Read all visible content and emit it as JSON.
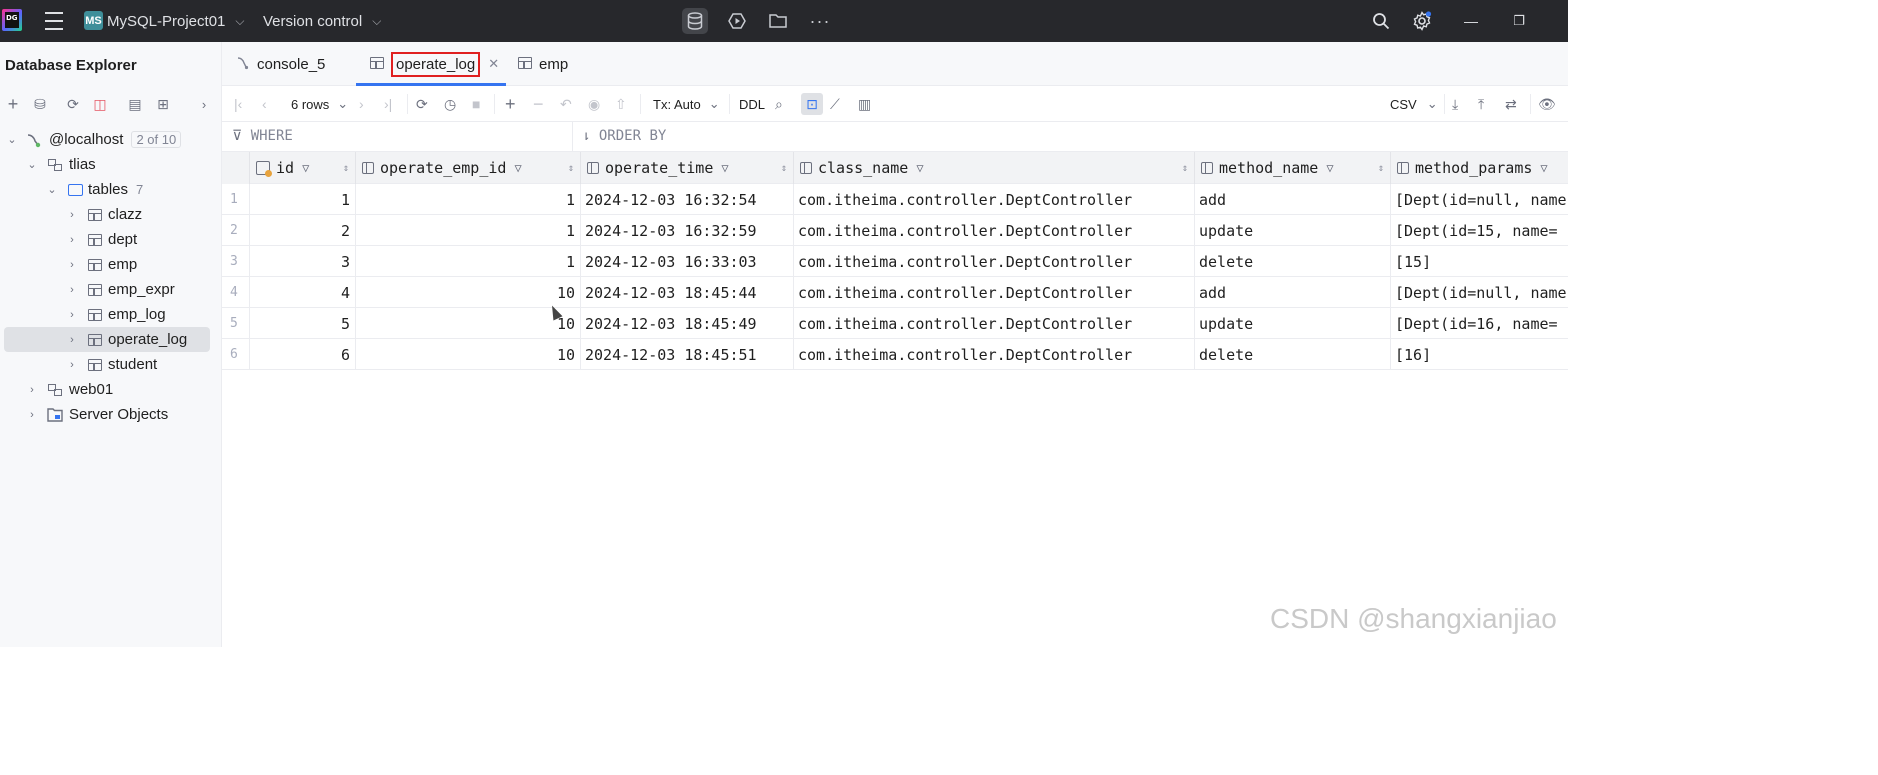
{
  "titlebar": {
    "project_badge": "MS",
    "project_name": "MySQL-Project01",
    "vcs_label": "Version control",
    "ide_logo": "DG"
  },
  "sidebar": {
    "title": "Database Explorer",
    "tree": {
      "host": {
        "label": "@localhost",
        "count": "2 of 10"
      },
      "schema_tlias": {
        "label": "tlias"
      },
      "tables_folder": {
        "label": "tables",
        "count": "7"
      },
      "tables": [
        "clazz",
        "dept",
        "emp",
        "emp_expr",
        "emp_log",
        "operate_log",
        "student"
      ],
      "schema_web01": {
        "label": "web01"
      },
      "server_objects": {
        "label": "Server Objects"
      }
    }
  },
  "tabs": [
    {
      "label": "console_5",
      "icon": "console-icon"
    },
    {
      "label": "operate_log",
      "icon": "table-icon"
    },
    {
      "label": "emp",
      "icon": "table-icon"
    }
  ],
  "grid_toolbar": {
    "rows_label": "6 rows",
    "tx_label": "Tx: Auto",
    "ddl_label": "DDL",
    "export_format": "CSV"
  },
  "filter": {
    "where_placeholder": "WHERE",
    "orderby_placeholder": "ORDER BY"
  },
  "table": {
    "columns": [
      "id",
      "operate_emp_id",
      "operate_time",
      "class_name",
      "method_name",
      "method_params"
    ],
    "rows": [
      {
        "row_num": "1",
        "id": "1",
        "operate_emp_id": "1",
        "operate_time": "2024-12-03 16:32:54",
        "class_name": "com.itheima.controller.DeptController",
        "method_name": "add",
        "method_params": "[Dept(id=null, name"
      },
      {
        "row_num": "2",
        "id": "2",
        "operate_emp_id": "1",
        "operate_time": "2024-12-03 16:32:59",
        "class_name": "com.itheima.controller.DeptController",
        "method_name": "update",
        "method_params": "[Dept(id=15, name="
      },
      {
        "row_num": "3",
        "id": "3",
        "operate_emp_id": "1",
        "operate_time": "2024-12-03 16:33:03",
        "class_name": "com.itheima.controller.DeptController",
        "method_name": "delete",
        "method_params": "[15]"
      },
      {
        "row_num": "4",
        "id": "4",
        "operate_emp_id": "10",
        "operate_time": "2024-12-03 18:45:44",
        "class_name": "com.itheima.controller.DeptController",
        "method_name": "add",
        "method_params": "[Dept(id=null, name"
      },
      {
        "row_num": "5",
        "id": "5",
        "operate_emp_id": "10",
        "operate_time": "2024-12-03 18:45:49",
        "class_name": "com.itheima.controller.DeptController",
        "method_name": "update",
        "method_params": "[Dept(id=16, name="
      },
      {
        "row_num": "6",
        "id": "6",
        "operate_emp_id": "10",
        "operate_time": "2024-12-03 18:45:51",
        "class_name": "com.itheima.controller.DeptController",
        "method_name": "delete",
        "method_params": "[16]"
      }
    ]
  },
  "watermark": "CSDN @shangxianjiao",
  "colors": {
    "titlebar_bg": "#27282c",
    "accent": "#3574f0",
    "highlight_box": "#e02020",
    "sidebar_bg": "#f7f8fa"
  }
}
